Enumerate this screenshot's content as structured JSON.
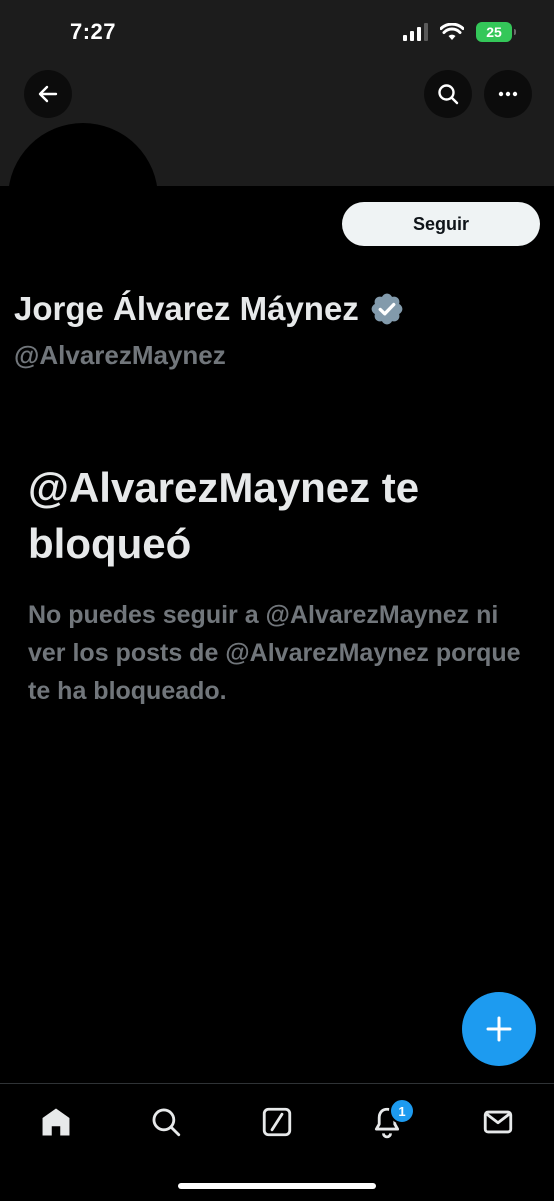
{
  "status_bar": {
    "time": "7:27",
    "battery": "25"
  },
  "profile": {
    "display_name": "Jorge Álvarez Máynez",
    "handle": "@AlvarezMaynez",
    "verified": true,
    "follow_label": "Seguir"
  },
  "blocked": {
    "title": "@AlvarezMaynez te bloqueó",
    "description": "No puedes seguir a @AlvarezMaynez ni ver los posts de @AlvarezMaynez porque te ha bloqueado."
  },
  "nav": {
    "items": [
      {
        "icon": "home-icon"
      },
      {
        "icon": "search-icon"
      },
      {
        "icon": "grok-icon"
      },
      {
        "icon": "notifications-icon",
        "badge": "1"
      },
      {
        "icon": "messages-icon"
      }
    ]
  },
  "colors": {
    "accent": "#1d9bf0",
    "background": "#000000",
    "banner": "#1c1c1c",
    "text_primary": "#e7e9ea",
    "text_secondary": "#71767b",
    "verified": "#829aab"
  }
}
